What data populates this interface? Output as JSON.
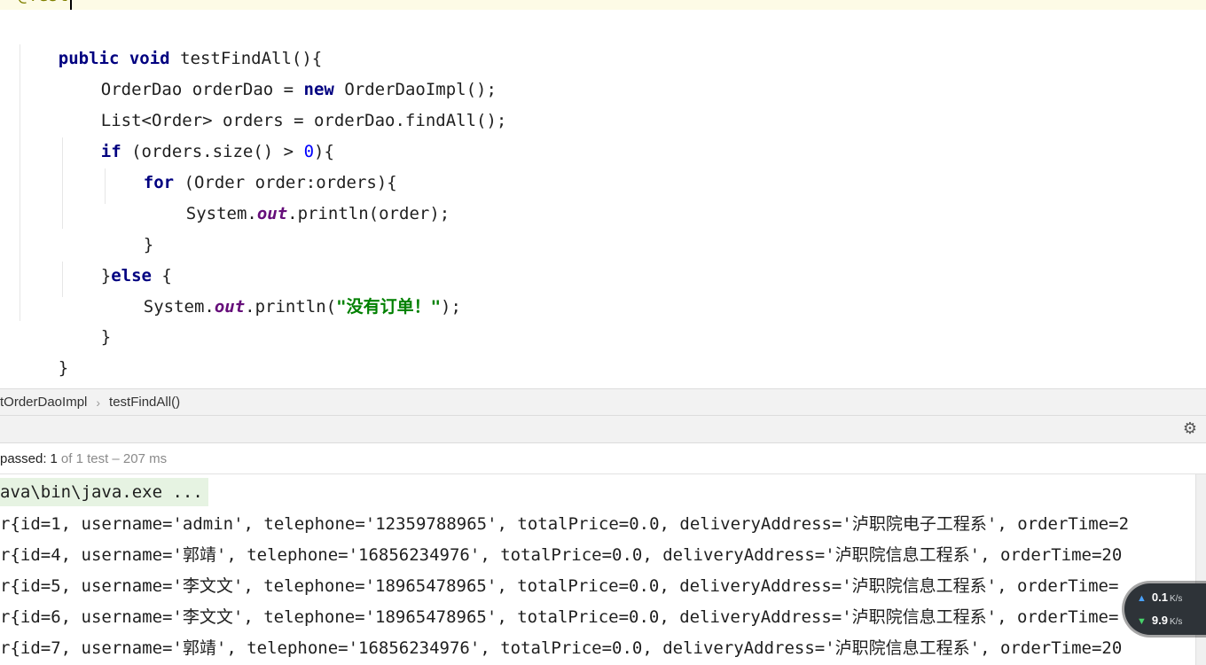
{
  "editor": {
    "annotation": "@Test",
    "code": {
      "l1": [
        "public",
        " ",
        "void",
        " testFindAll(){"
      ],
      "l2": [
        "OrderDao orderDao = ",
        "new",
        " OrderDaoImpl();"
      ],
      "l3": "List<Order> orders = orderDao.findAll();",
      "l4": [
        "if",
        " (orders.size() > ",
        "0",
        "){"
      ],
      "l5": [
        "for",
        " (Order order:orders){"
      ],
      "l6": [
        "System.",
        "out",
        ".println(order);"
      ],
      "l7": "}",
      "l8": [
        "}",
        "else",
        " {"
      ],
      "l9": [
        "System.",
        "out",
        ".println(",
        "\"没有订单！\"",
        ");"
      ],
      "l10": "}",
      "l11": "}"
    }
  },
  "breadcrumb": {
    "items": [
      "tOrderDaoImpl",
      "testFindAll()"
    ],
    "separator": "›"
  },
  "toolbar": {
    "settings_icon": "gear-icon"
  },
  "status": {
    "label": "passed:",
    "count": "1",
    "rest": "of 1 test – 207 ms"
  },
  "console": {
    "command": "ava\\bin\\java.exe ...",
    "lines": [
      "r{id=1, username='admin', telephone='12359788965', totalPrice=0.0, deliveryAddress='泸职院电子工程系', orderTime=2",
      "r{id=4, username='郭靖', telephone='16856234976', totalPrice=0.0, deliveryAddress='泸职院信息工程系', orderTime=20",
      "r{id=5, username='李文文', telephone='18965478965', totalPrice=0.0, deliveryAddress='泸职院信息工程系', orderTime=",
      "r{id=6, username='李文文', telephone='18965478965', totalPrice=0.0, deliveryAddress='泸职院信息工程系', orderTime=",
      "r{id=7, username='郭靖', telephone='16856234976', totalPrice=0.0, deliveryAddress='泸职院信息工程系', orderTime=20"
    ]
  },
  "net_widget": {
    "upload": "0.1",
    "download": "9.9",
    "unit": "K/s"
  },
  "colors": {
    "keyword": "#000080",
    "number": "#0000ff",
    "static_field": "#660e7a",
    "string": "#008000",
    "command_highlight": "#e6f3e2"
  }
}
